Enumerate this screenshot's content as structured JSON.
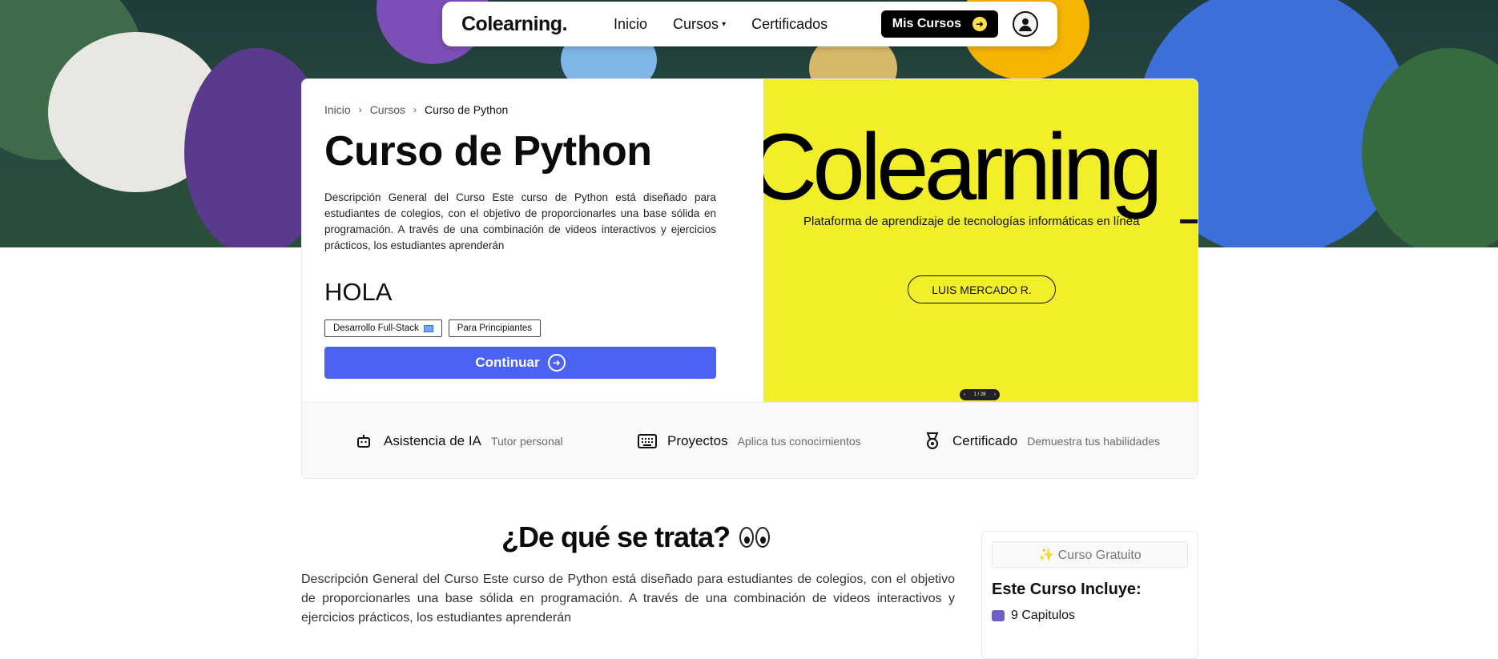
{
  "nav": {
    "brand": "Colearning.",
    "links": [
      "Inicio",
      "Cursos",
      "Certificados"
    ],
    "cursos_chevron": "ˇ",
    "my_courses": "Mis Cursos"
  },
  "course": {
    "breadcrumb": [
      "Inicio",
      "Cursos",
      "Curso de Python"
    ],
    "title": "Curso de Python",
    "description": "Descripción General del Curso Este curso de Python está diseñado para estudiantes de colegios, con el objetivo de proporcionarles una base sólida en programación. A través de una combinación de videos interactivos y ejercicios prácticos, los estudiantes aprenderán",
    "subtitle": "HOLA",
    "tags": [
      "Desarrollo Full-Stack",
      "Para Principiantes"
    ],
    "continue_label": "Continuar"
  },
  "preview": {
    "brand": "Colearning",
    "tagline": "Plataforma de aprendizaje de tecnologías informáticas en línea",
    "author": "LUIS MERCADO R.",
    "pager": "1 / 28"
  },
  "features": [
    {
      "name": "Asistencia de IA",
      "sub": "Tutor personal",
      "icon": "robot-icon"
    },
    {
      "name": "Proyectos",
      "sub": "Aplica tus conocimientos",
      "icon": "keyboard-icon"
    },
    {
      "name": "Certificado",
      "sub": "Demuestra tus habilidades",
      "icon": "medal-icon"
    }
  ],
  "section": {
    "heading": "¿De qué se trata?",
    "description": "Descripción General del Curso Este curso de Python está diseñado para estudiantes de colegios, con el objetivo de proporcionarles una base sólida en programación. A través de una combinación de videos interactivos y ejercicios prácticos, los estudiantes aprenderán"
  },
  "sidebar": {
    "free_label": "✨ Curso Gratuito",
    "includes_title": "Este Curso Incluye:",
    "items": [
      "9 Capitulos"
    ]
  },
  "colors": {
    "accent": "#4b63f2",
    "preview_bg": "#f2ef2a"
  }
}
